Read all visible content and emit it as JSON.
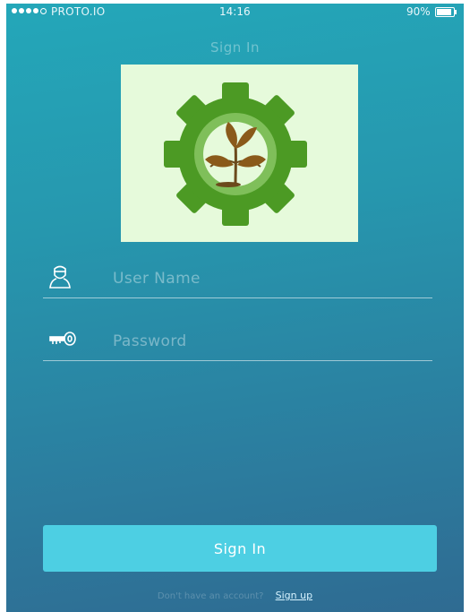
{
  "status_bar": {
    "carrier": "PROTO.IO",
    "time": "14:16",
    "battery_percent": "90%",
    "battery_level": 0.9,
    "signal_bars_filled": 4,
    "signal_bars_total": 5
  },
  "screen": {
    "title": "Sign In"
  },
  "logo": {
    "icon": "gear-with-sprout-icon",
    "background_color": "#e6fadb",
    "gear_color": "#4c9a24",
    "sprout_color": "#8a5a1a"
  },
  "form": {
    "username": {
      "placeholder": "User Name",
      "value": "",
      "icon": "user-icon"
    },
    "password": {
      "placeholder": "Password",
      "value": "",
      "icon": "key-icon"
    }
  },
  "actions": {
    "sign_in_label": "Sign In",
    "sign_in_color": "#4dcfe3"
  },
  "footer": {
    "question": "Don't have an account?",
    "signup_label": "Sign up"
  }
}
